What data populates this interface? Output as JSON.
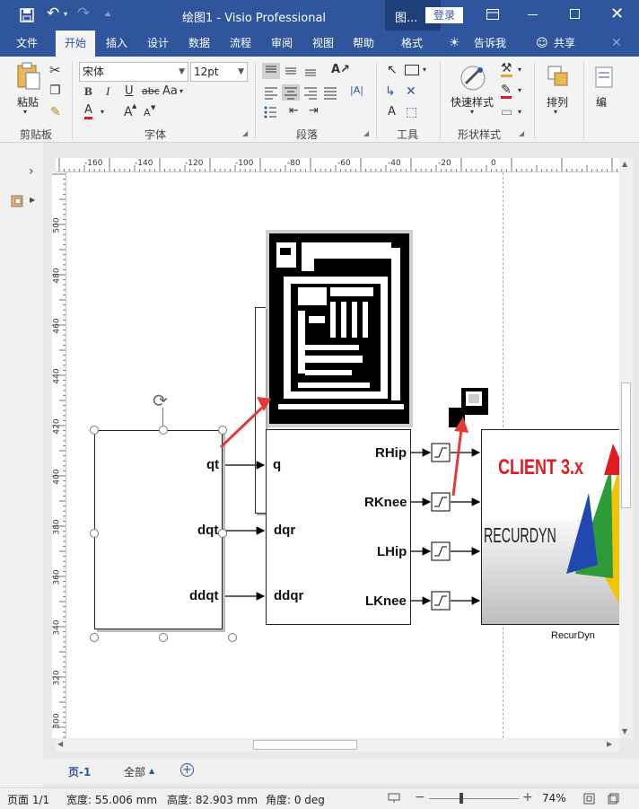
{
  "title_bar": {
    "doc_title": "绘图1 - Visio Professional",
    "context_label": "图...",
    "login_label": "登录"
  },
  "tabs": {
    "file": "文件",
    "home": "开始",
    "insert": "插入",
    "design": "设计",
    "data": "数据",
    "process": "流程",
    "review": "审阅",
    "view": "视图",
    "help": "帮助",
    "format": "格式",
    "tell_me": "告诉我",
    "share": "共享"
  },
  "ribbon": {
    "clipboard": {
      "paste_label": "粘贴",
      "group_label": "剪贴板"
    },
    "font": {
      "font_name": "宋体",
      "font_size": "12pt",
      "bold": "B",
      "italic": "I",
      "underline": "U",
      "strike": "abc",
      "change_case": "Aa",
      "font_color": "A",
      "grow_font": "A",
      "shrink_font": "A",
      "group_label": "字体"
    },
    "paragraph": {
      "group_label": "段落"
    },
    "tools": {
      "group_label": "工具",
      "text_tool": "A"
    },
    "shape_styles": {
      "quick_styles_label": "快速样式",
      "group_label": "形状样式"
    },
    "arrange": {
      "label": "排列"
    },
    "edit": {
      "label": "编"
    }
  },
  "rulers": {
    "h_ticks": [
      "-160",
      "-140",
      "-120",
      "-100",
      "-80",
      "-60",
      "-40",
      "-20",
      "0"
    ],
    "v_ticks": [
      "500",
      "480",
      "460",
      "440",
      "420",
      "400",
      "380",
      "360",
      "340",
      "320",
      "300"
    ]
  },
  "diagram": {
    "source_outputs": [
      "qt",
      "dqt",
      "ddqt"
    ],
    "mux_inputs": [
      "q",
      "dqr",
      "ddqr"
    ],
    "mux_outputs": [
      "RHip",
      "RKnee",
      "LHip",
      "LKnee"
    ],
    "plant_logo_line1": "CLIENT 3.x",
    "plant_logo_line2": "RECURDYN",
    "plant_caption": "RecurDyn"
  },
  "page_tabs": {
    "current_page": "页-1",
    "all_pages": "全部"
  },
  "status_bar": {
    "page": "页面 1/1",
    "width": "宽度: 55.006 mm",
    "height": "高度: 82.903 mm",
    "angle": "角度: 0 deg",
    "zoom": "74%"
  },
  "colors": {
    "brand_blue": "#2f569c",
    "context_tab": "#1f3f7a",
    "arrow_red": "#e53935",
    "logo_red": "#e21b22"
  }
}
